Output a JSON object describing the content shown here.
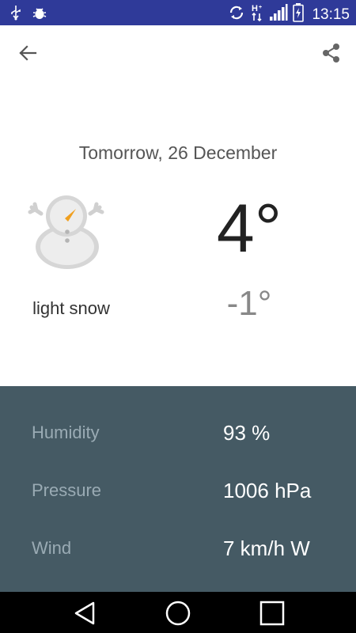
{
  "status_bar": {
    "time": "13:15",
    "left_icons": [
      "usb-icon",
      "bug-icon"
    ],
    "right_icons": [
      "sync-icon",
      "data-hplus-icon",
      "signal-icon",
      "battery-icon"
    ]
  },
  "toolbar": {
    "back_icon": "arrow-back-icon",
    "share_icon": "share-icon"
  },
  "forecast": {
    "date": "Tomorrow, 26 December",
    "condition": "light snow",
    "condition_icon": "snowman-icon",
    "temp_high": "4°",
    "temp_low": "-1°"
  },
  "details": [
    {
      "label": "Humidity",
      "value": "93 %"
    },
    {
      "label": "Pressure",
      "value": "1006 hPa"
    },
    {
      "label": "Wind",
      "value": "7 km/h W"
    }
  ],
  "nav": [
    "back-triangle-icon",
    "home-circle-icon",
    "recents-square-icon"
  ],
  "colors": {
    "status_bar": "#2f3a99",
    "details_panel": "#455a64",
    "detail_label": "#9aabb4"
  }
}
